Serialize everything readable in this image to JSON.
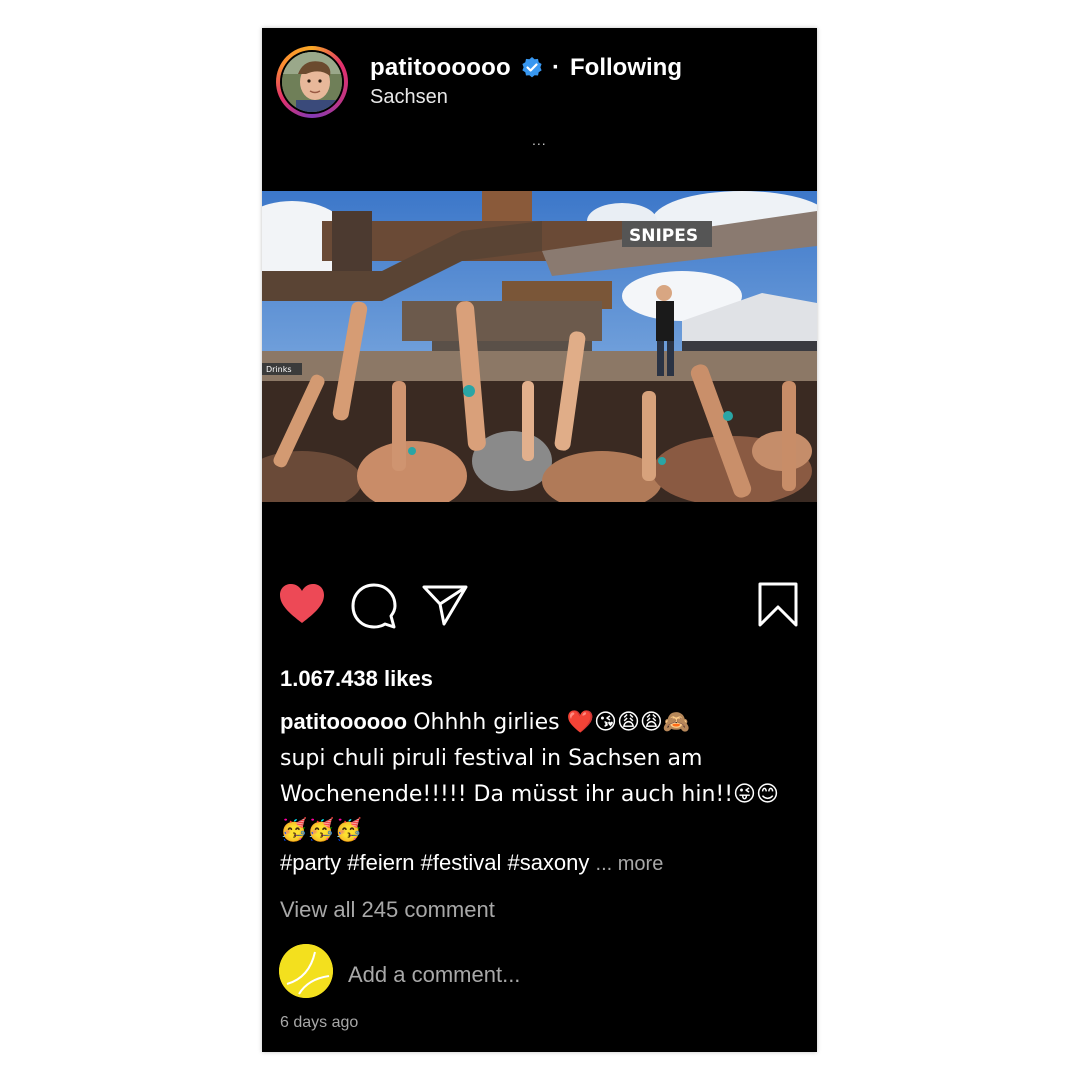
{
  "header": {
    "username": "patitoooooo",
    "separator": "·",
    "follow_status": "Following",
    "location": "Sachsen",
    "options": "..."
  },
  "photo": {
    "stage_sign": "SNIPES",
    "bar_sign": "Drinks"
  },
  "actions": {
    "like_color": "#ed4956",
    "liked": true
  },
  "likes": "1.067.438 likes",
  "caption": {
    "username": "patitoooooo",
    "line1": "Ohhhh girlies ❤️😘😩😩🙈",
    "line2": "supi chuli piruli festival in Sachsen am",
    "line3": "Wochenende!!!!! Da müsst ihr auch hin!!😜😊",
    "line4": "🥳🥳🥳",
    "hashtags": "#party #feiern #festival #saxony",
    "more_label": "... more"
  },
  "comments": {
    "view_all": "View all 245 comment",
    "placeholder": "Add a comment..."
  },
  "timestamp": "6 days ago"
}
